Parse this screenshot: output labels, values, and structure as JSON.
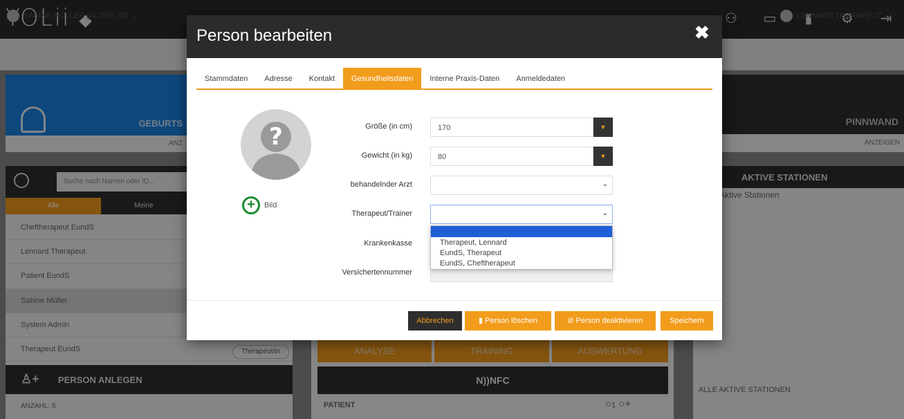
{
  "app": {
    "logo": "YOLii"
  },
  "topnav": {
    "icons": [
      "users-icon",
      "folder-icon",
      "chart-icon",
      "gear-icon",
      "logout-icon"
    ]
  },
  "userbar": {
    "patient": "SABINE MÜLLER (ALTER: 33)",
    "therapist": "LENNARD THERAPEUT"
  },
  "background": {
    "blue_tile_label": "GEBURTS",
    "anz1": "ANZ",
    "pinnwand": "PINNWAND",
    "anzeigen": "ANZEIGEN",
    "search_placeholder": "Suche nach Namen oder ID...",
    "filter_tabs": [
      "Alle",
      "Meine"
    ],
    "people": [
      "Cheftherapeut EundS",
      "Lennard Therapeut",
      "Patient EundS",
      "Sabine Müller",
      "System Admin",
      "Therapeut EundS"
    ],
    "badge": "Therapeut/in",
    "person_anlegen": "PERSON ANLEGEN",
    "anzahl": "ANZAHL: 6",
    "analyse": "ANALYSE",
    "training": "TRAINING",
    "auswertung": "AUSWERTUNG",
    "nfc": "NFC",
    "patient_label": "PATIENT",
    "chat_count": "1",
    "aktive_stationen": "AKTIVE STATIONEN",
    "aktive_sub": "Aktive Stationen",
    "alle_aktive": "ALLE AKTIVE STATIONEN"
  },
  "modal": {
    "title": "Person bearbeiten",
    "close": "✖",
    "tabs": [
      "Stammdaten",
      "Adresse",
      "Kontakt",
      "Gesundheitsdaten",
      "Interne Praxis-Daten",
      "Anmeldedaten"
    ],
    "active_tab": "Gesundheitsdaten",
    "add_picture": "Bild",
    "fields": {
      "groesse_label": "Größe (in cm)",
      "groesse_value": "170",
      "gewicht_label": "Gewicht (in kg)",
      "gewicht_value": "80",
      "arzt_label": "behandelnder Arzt",
      "arzt_value": "",
      "therapeut_label": "Therapeut/Trainer",
      "therapeut_value": "",
      "krankenkasse_label": "Krankenkasse",
      "versicherung_label": "Versichertennummer"
    },
    "dropdown_options": [
      "Therapeut, Lennard",
      "EundS, Therapeut",
      "EundS, Cheftherapeut"
    ],
    "buttons": {
      "cancel": "Abbrechen",
      "delete": "Person löschen",
      "deactivate": "Person deaktivieren",
      "save": "Speichern"
    }
  },
  "colors": {
    "accent": "#f29c1c",
    "dark": "#2b2b2b",
    "blue": "#1a82e2",
    "highlight": "#1e5fd8",
    "green": "#1a8a2e"
  }
}
